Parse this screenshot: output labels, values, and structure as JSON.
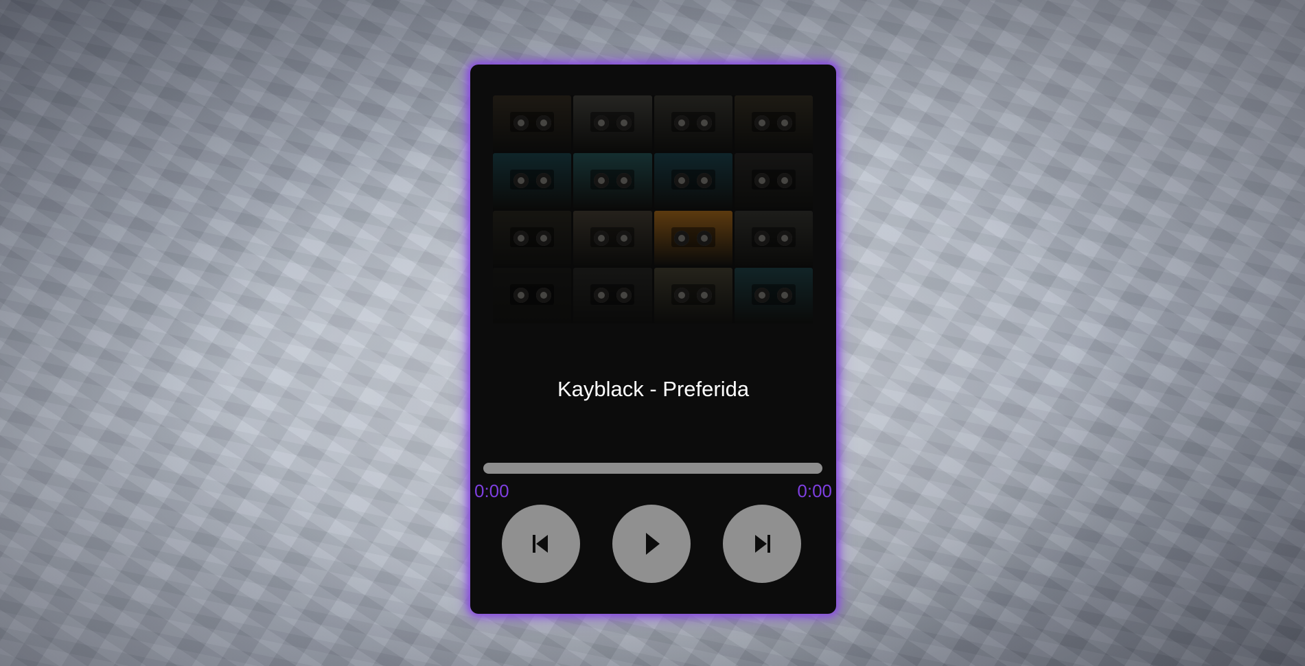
{
  "player": {
    "song_title": "Kayblack - Preferida",
    "current_time": "0:00",
    "duration": "0:00",
    "progress": 0,
    "accent_color": "#8a4fe0",
    "time_color": "#7e3fe0"
  },
  "controls": {
    "previous_icon": "skip-previous-icon",
    "play_icon": "play-icon",
    "next_icon": "skip-next-icon"
  },
  "cover": {
    "icon": "cassette-tapes-album-art",
    "tape_colors": [
      "#3a3226",
      "#4b4a44",
      "#3e3d36",
      "#3b3528",
      "#1f4a52",
      "#2a5d60",
      "#1f4a55",
      "#2b2a28",
      "#2c2a22",
      "#4a4338",
      "#b8741e",
      "#3a3a35",
      "#1c1c1a",
      "#2a2a28",
      "#4a4636",
      "#23484e"
    ]
  }
}
